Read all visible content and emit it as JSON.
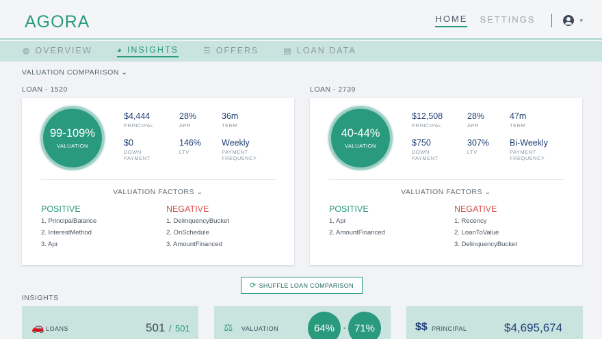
{
  "brand": "AGORA",
  "topnav": {
    "home": "HOME",
    "settings": "SETTINGS",
    "caret": "▾"
  },
  "tabs": [
    {
      "label": "OVERVIEW",
      "icon": "dashboard-icon",
      "glyph": "◍"
    },
    {
      "label": "INSIGHTS",
      "icon": "pie-chart-icon",
      "glyph": "◕"
    },
    {
      "label": "OFFERS",
      "icon": "database-icon",
      "glyph": "☰"
    },
    {
      "label": "LOAN DATA",
      "icon": "document-icon",
      "glyph": "▤"
    }
  ],
  "valuation_comparison": "VALUATION COMPARISON",
  "vc_caret": "⌄",
  "loans": [
    {
      "heading": "LOAN - 1520",
      "valuation": "99-109%",
      "valuation_label": "VALUATION",
      "stats": [
        {
          "value": "$4,444",
          "label": "PRINCIPAL"
        },
        {
          "value": "28%",
          "label": "APR"
        },
        {
          "value": "36m",
          "label": "TERM"
        },
        {
          "value": "$0",
          "label": "DOWN PAYMENT"
        },
        {
          "value": "146%",
          "label": "LTV"
        },
        {
          "value": "Weekly",
          "label": "PAYMENT FREQUENCY"
        }
      ],
      "factors_label": "VALUATION FACTORS ⌄",
      "positive_label": "POSITIVE",
      "negative_label": "NEGATIVE",
      "positive": [
        "1. PrincipalBalance",
        "2. InterestMethod",
        "3. Apr"
      ],
      "negative": [
        "1. DelinquencyBucket",
        "2. OnSchedule",
        "3. AmountFinanced"
      ]
    },
    {
      "heading": "LOAN - 2739",
      "valuation": "40-44%",
      "valuation_label": "VALUATION",
      "stats": [
        {
          "value": "$12,508",
          "label": "PRINCIPAL"
        },
        {
          "value": "28%",
          "label": "APR"
        },
        {
          "value": "47m",
          "label": "TERM"
        },
        {
          "value": "$750",
          "label": "DOWN PAYMENT"
        },
        {
          "value": "307%",
          "label": "LTV"
        },
        {
          "value": "Bi-Weekly",
          "label": "PAYMENT FREQUENCY"
        }
      ],
      "factors_label": "VALUATION FACTORS ⌄",
      "positive_label": "POSITIVE",
      "negative_label": "NEGATIVE",
      "positive": [
        "1. Apr",
        "2. AmountFinanced"
      ],
      "negative": [
        "1. Recency",
        "2. LoanToValue",
        "3. DelinquencyBucket"
      ]
    }
  ],
  "shuffle_label": "SHUFFLE LOAN COMPARISON",
  "shuffle_glyph": "⟳",
  "insights_heading": "INSIGHTS",
  "insights": {
    "loans": {
      "label": "LOANS",
      "value": "501",
      "sep": "/",
      "total": "501",
      "glyph": "🚗"
    },
    "valuation": {
      "label": "VALUATION",
      "a": "64%",
      "sep": "-",
      "b": "71%",
      "glyph": "⚖"
    },
    "principal": {
      "label": "PRINCIPAL",
      "value": "$4,695,674",
      "glyph": "$$"
    }
  },
  "colors": {
    "accent": "#2a9a7f",
    "negative": "#d9534f",
    "value_text": "#1f3f74",
    "tab_bar": "#c9e3df"
  }
}
